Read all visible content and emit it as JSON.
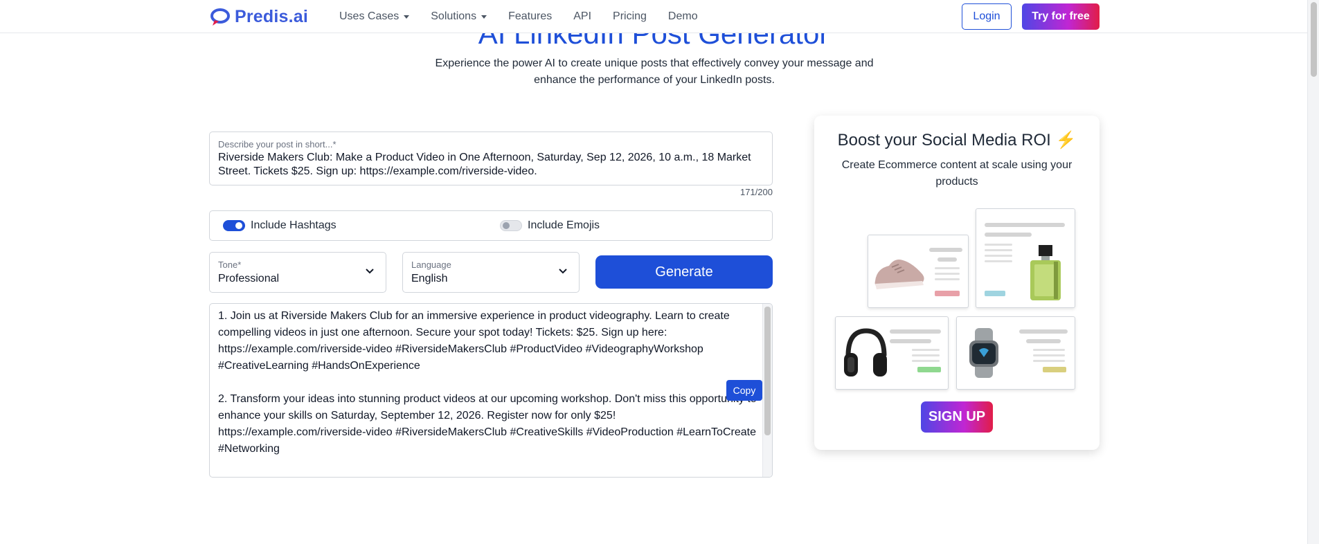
{
  "brand": {
    "name": "Predis.ai",
    "color": "#3b5bdb"
  },
  "nav": {
    "items": [
      {
        "label": "Uses Cases",
        "has_dropdown": true
      },
      {
        "label": "Solutions",
        "has_dropdown": true
      },
      {
        "label": "Features",
        "has_dropdown": false
      },
      {
        "label": "API",
        "has_dropdown": false
      },
      {
        "label": "Pricing",
        "has_dropdown": false
      },
      {
        "label": "Demo",
        "has_dropdown": false
      }
    ],
    "login_label": "Login",
    "try_label": "Try for free"
  },
  "hero": {
    "title": "AI LinkedIn Post Generator",
    "subtitle": "Experience the power AI to create unique posts that effectively convey your message and enhance the performance of your LinkedIn posts."
  },
  "form": {
    "describe": {
      "label": "Describe your post in short...*",
      "value": "Riverside Makers Club: Make a Product Video in One Afternoon, Saturday, Sep 12, 2026, 10 a.m., 18 Market Street. Tickets $25. Sign up: https://example.com/riverside-video.",
      "char_count": "171/200"
    },
    "hashtags": {
      "label": "Include Hashtags",
      "enabled": true
    },
    "emojis": {
      "label": "Include Emojis",
      "enabled": false
    },
    "tone": {
      "label": "Tone*",
      "value": "Professional"
    },
    "language": {
      "label": "Language",
      "value": "English"
    },
    "generate_label": "Generate"
  },
  "output": {
    "paragraphs": [
      "1. Join us at Riverside Makers Club for an immersive experience in product videography. Learn to create compelling videos in just one afternoon. Secure your spot today! Tickets: $25. Sign up here: https://example.com/riverside-video #RiversideMakersClub #ProductVideo #VideographyWorkshop #CreativeLearning #HandsOnExperience",
      "2. Transform your ideas into stunning product videos at our upcoming workshop. Don't miss this opportunity to enhance your skills on Saturday, September 12, 2026. Register now for only $25! https://example.com/riverside-video #RiversideMakersClub #CreativeSkills #VideoProduction #LearnToCreate #Networking"
    ],
    "copy_label": "Copy"
  },
  "promo": {
    "title": "Boost your Social Media ROI",
    "title_emoji": "⚡",
    "subtitle": "Create Ecommerce content at scale using your products",
    "signup_label": "SIGN UP",
    "products": [
      {
        "icon": "sneaker-icon",
        "tag_color": "#e8a0a8"
      },
      {
        "icon": "perfume-bottle-icon",
        "tag_color": "#9fd4e0"
      },
      {
        "icon": "headphones-icon",
        "tag_color": "#8fd88f"
      },
      {
        "icon": "smartwatch-icon",
        "tag_color": "#d9cf7e"
      }
    ]
  },
  "colors": {
    "accent": "#1e4fd8",
    "gradient_start": "#4f46e5",
    "gradient_end": "#e11d48"
  }
}
